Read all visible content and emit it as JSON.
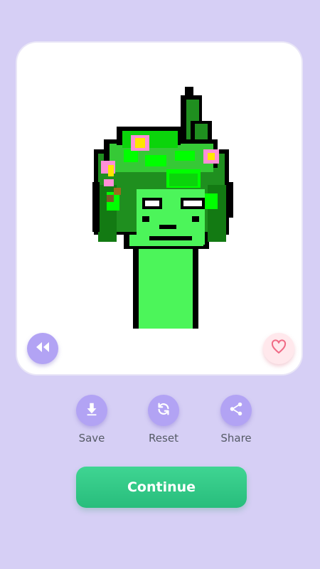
{
  "actions": {
    "save_label": "Save",
    "reset_label": "Reset",
    "share_label": "Share"
  },
  "continue_label": "Continue",
  "icons": {
    "rewind": "rewind-icon",
    "favorite": "heart-icon",
    "save": "download-icon",
    "reset": "refresh-icon",
    "share": "share-icon"
  },
  "colors": {
    "background": "#d6cff5",
    "accent": "#b2a3f4",
    "continue": "#2ec985",
    "heart": "#f06a85"
  }
}
